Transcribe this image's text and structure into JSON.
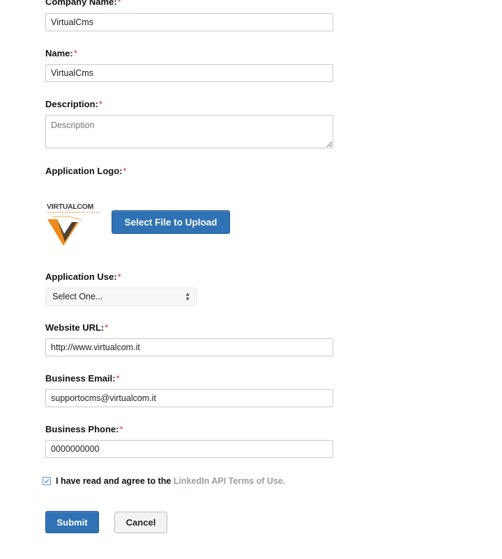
{
  "form": {
    "required_mark": "*",
    "company_name": {
      "label": "Company Name:",
      "value": "VirtualCms"
    },
    "name": {
      "label": "Name:",
      "value": "VirtualCms"
    },
    "description": {
      "label": "Description:",
      "placeholder": "Description"
    },
    "logo": {
      "label": "Application Logo:",
      "image_text": "VIRTUALCOM",
      "upload_button": "Select File to Upload"
    },
    "application_use": {
      "label": "Application Use:",
      "selected": "Select One..."
    },
    "website_url": {
      "label": "Website URL:",
      "value": "http://www.virtualcom.it"
    },
    "business_email": {
      "label": "Business Email:",
      "value": "supportocms@virtualcom.it"
    },
    "business_phone": {
      "label": "Business Phone:",
      "value": "0000000000"
    },
    "agree": {
      "checked": true,
      "text": "I have read and agree to the",
      "link": "LinkedIn API Terms of Use."
    },
    "submit_label": "Submit",
    "cancel_label": "Cancel"
  },
  "colors": {
    "primary_button": "#2f72b5",
    "required_mark": "#e0262b",
    "link": "#9a9ea3",
    "logo_orange": "#f08a1c",
    "logo_dark": "#3a3a3a"
  }
}
